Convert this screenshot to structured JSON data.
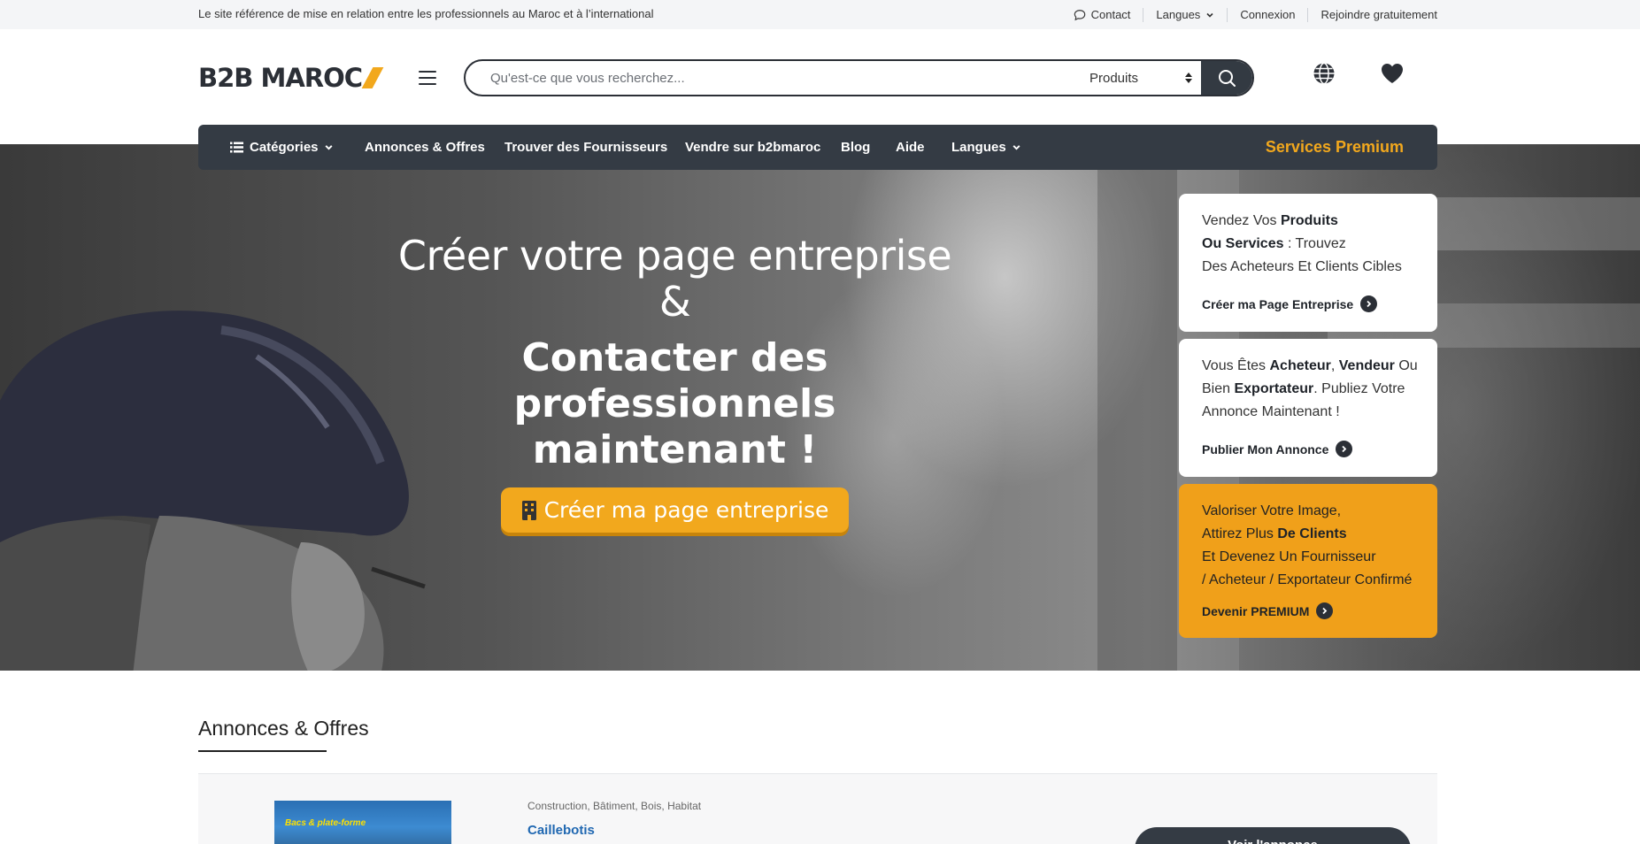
{
  "topbar": {
    "tagline": "Le site référence de mise en relation entre les professionnels au Maroc et à l’international",
    "links": {
      "contact": "Contact",
      "langues": "Langues",
      "connexion": "Connexion",
      "rejoindre": "Rejoindre gratuitement"
    }
  },
  "header": {
    "logo": "B2B MAROC",
    "search": {
      "placeholder": "Qu'est-ce que vous recherchez...",
      "category": "Produits"
    }
  },
  "nav": {
    "categories": "Catégories",
    "annonces": "Annonces & Offres",
    "fournisseurs": "Trouver des Fournisseurs",
    "vendre": "Vendre sur b2bmaroc",
    "blog": "Blog",
    "aide": "Aide",
    "langues": "Langues",
    "premium": "Services Premium"
  },
  "hero": {
    "line1": "Créer votre page entreprise &",
    "line2": "Contacter des professionnels maintenant !",
    "cta": "Créer ma page entreprise"
  },
  "cards": {
    "card1": {
      "t1": "Vendez Vos ",
      "b1": "Produits",
      "b2": "Ou Services",
      "t2": " : Trouvez",
      "t3": "Des Acheteurs Et Clients Cibles",
      "link": "Créer ma Page Entreprise"
    },
    "card2": {
      "t1": "Vous Êtes ",
      "b1": "Acheteur",
      "t2": ", ",
      "b2": "Vendeur",
      "t3": " Ou Bien ",
      "b3": "Exportateur",
      "t4": ". Publiez Votre Annonce Maintenant !",
      "link": "Publier Mon Annonce"
    },
    "card3": {
      "t1": "Valoriser Votre Image,",
      "t2": "Attirez Plus ",
      "b1": "De Clients",
      "t3": "Et Devenez Un Fournisseur",
      "t4": "/ Acheteur / Exportateur Confirmé",
      "link": "Devenir PREMIUM"
    }
  },
  "annonces": {
    "title": "Annonces & Offres",
    "items": [
      {
        "category": "Construction, Bâtiment, Bois, Habitat",
        "title": "Caillebotis",
        "thumb_text": "Bacs & plate-forme",
        "button": "Voir l'annonce"
      }
    ]
  },
  "colors": {
    "accent": "#f2a81d",
    "dark": "#343b44",
    "link": "#1f67b1"
  }
}
